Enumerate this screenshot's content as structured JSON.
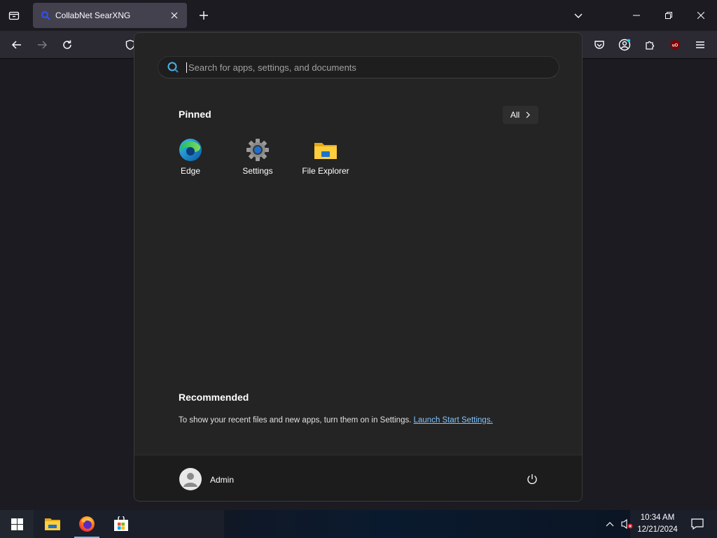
{
  "browser": {
    "tab_title": "CollabNet SearXNG",
    "tab_favicon": "searxng-icon",
    "ublock_badge": "UO"
  },
  "start_menu": {
    "search_placeholder": "Search for apps, settings, and documents",
    "pinned_title": "Pinned",
    "all_label": "All",
    "pinned_apps": [
      {
        "label": "Edge",
        "icon": "edge-icon"
      },
      {
        "label": "Settings",
        "icon": "settings-gear-icon"
      },
      {
        "label": "File Explorer",
        "icon": "folder-icon"
      }
    ],
    "recommended_title": "Recommended",
    "recommended_text": "To show your recent files and new apps, turn them on in Settings.",
    "recommended_link": "Launch Start Settings.",
    "user_name": "Admin"
  },
  "taskbar": {
    "time": "10:34 AM",
    "date": "12/21/2024",
    "apps": [
      "file-explorer",
      "firefox",
      "microsoft-store"
    ],
    "active_app": "firefox"
  },
  "colors": {
    "accent_link": "#7fc4ff",
    "start_bg": "#242424",
    "taskbar_active": "#76b9ed"
  }
}
